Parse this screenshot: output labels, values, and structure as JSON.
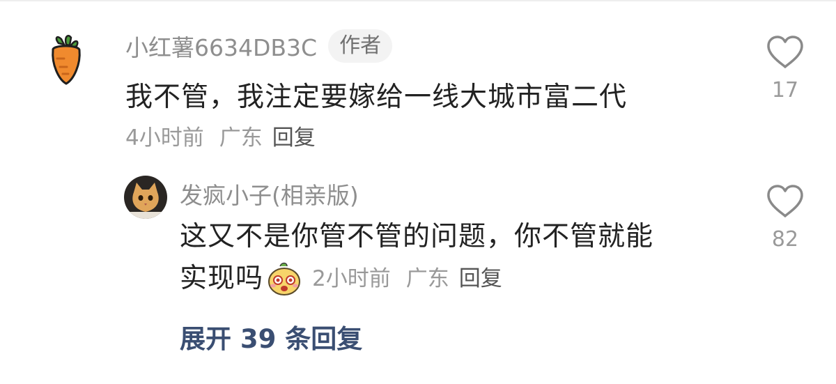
{
  "main_comment": {
    "author": "小红薯6634DB3C",
    "badge": "作者",
    "text": "我不管，我注定要嫁给一线大城市富二代",
    "time": "4小时前",
    "region": "广东",
    "reply_label": "回复",
    "likes": "17",
    "avatar_icon": "carrot-icon"
  },
  "reply": {
    "author": "发疯小子(相亲版)",
    "text_line1": "这又不是你管不管的问题，你不管就能",
    "text_line2": "实现吗",
    "emoji_icon": "cute-face-emoji-icon",
    "time": "2小时前",
    "region": "广东",
    "reply_label": "回复",
    "likes": "82",
    "avatar_icon": "cat-avatar"
  },
  "expand_replies": "展开 39 条回复",
  "colors": {
    "name": "#8e8e8e",
    "text": "#222222",
    "meta": "#999999",
    "expand": "#3a4e72",
    "carrot": "#f08a2e",
    "leaf": "#4a9a3a"
  }
}
